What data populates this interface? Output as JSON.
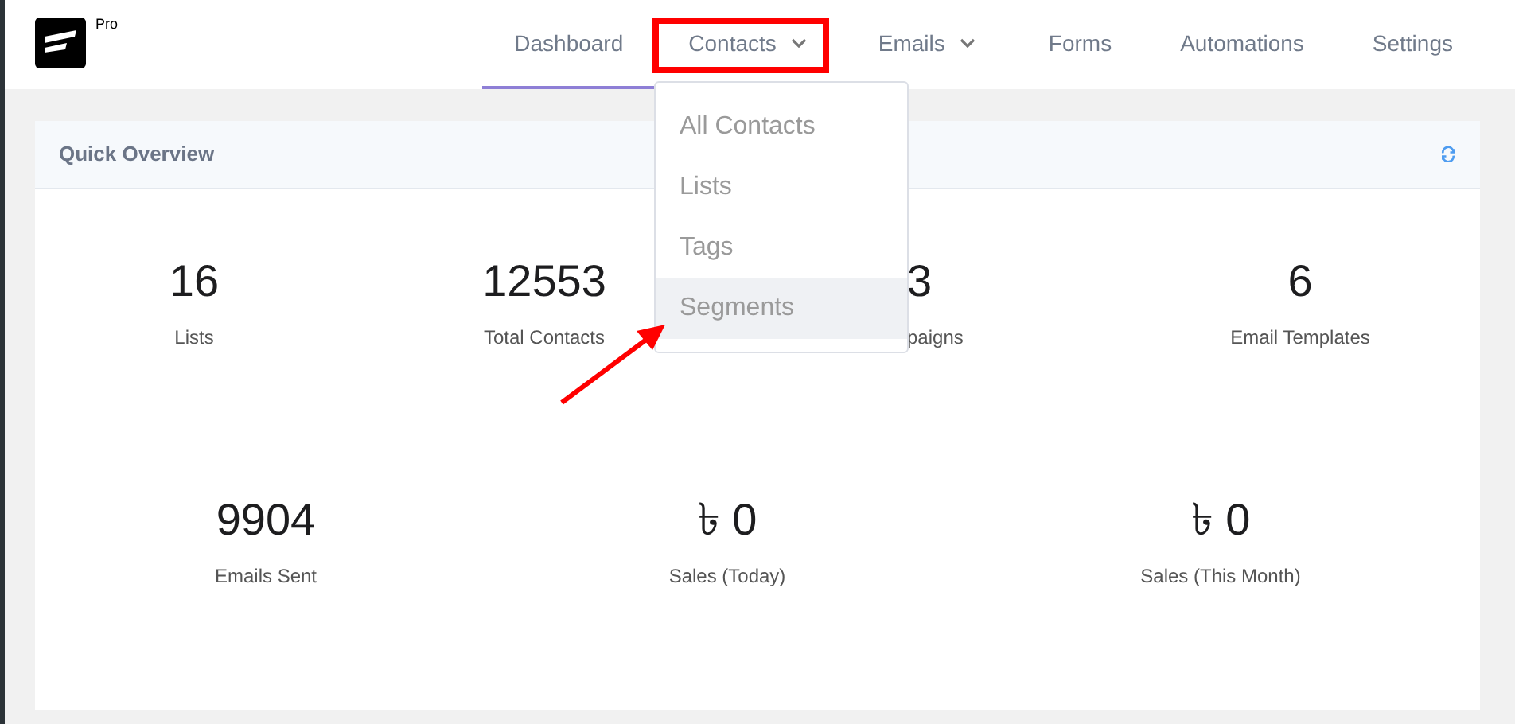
{
  "brand": {
    "badge": "Pro"
  },
  "nav": [
    {
      "label": "Dashboard",
      "selected": true,
      "dropdown": false
    },
    {
      "label": "Contacts",
      "selected": false,
      "dropdown": true
    },
    {
      "label": "Emails",
      "selected": false,
      "dropdown": true
    },
    {
      "label": "Forms",
      "selected": false,
      "dropdown": false
    },
    {
      "label": "Automations",
      "selected": false,
      "dropdown": false
    },
    {
      "label": "Settings",
      "selected": false,
      "dropdown": false
    }
  ],
  "contacts_menu": [
    {
      "label": "All Contacts",
      "selected": false
    },
    {
      "label": "Lists",
      "selected": false
    },
    {
      "label": "Tags",
      "selected": false
    },
    {
      "label": "Segments",
      "selected": true
    }
  ],
  "overview": {
    "title": "Quick Overview",
    "stats_row_1": [
      {
        "value": "16",
        "label": "Lists"
      },
      {
        "value": "12553",
        "label": "Total Contacts"
      },
      {
        "value": "3",
        "label": "paigns"
      },
      {
        "value": "6",
        "label": "Email Templates"
      }
    ],
    "stats_row_2": [
      {
        "value": "9904",
        "label": "Emails Sent"
      },
      {
        "value": "৳ 0",
        "label": "Sales (Today)"
      },
      {
        "value": "৳ 0",
        "label": "Sales (This Month)"
      }
    ]
  }
}
